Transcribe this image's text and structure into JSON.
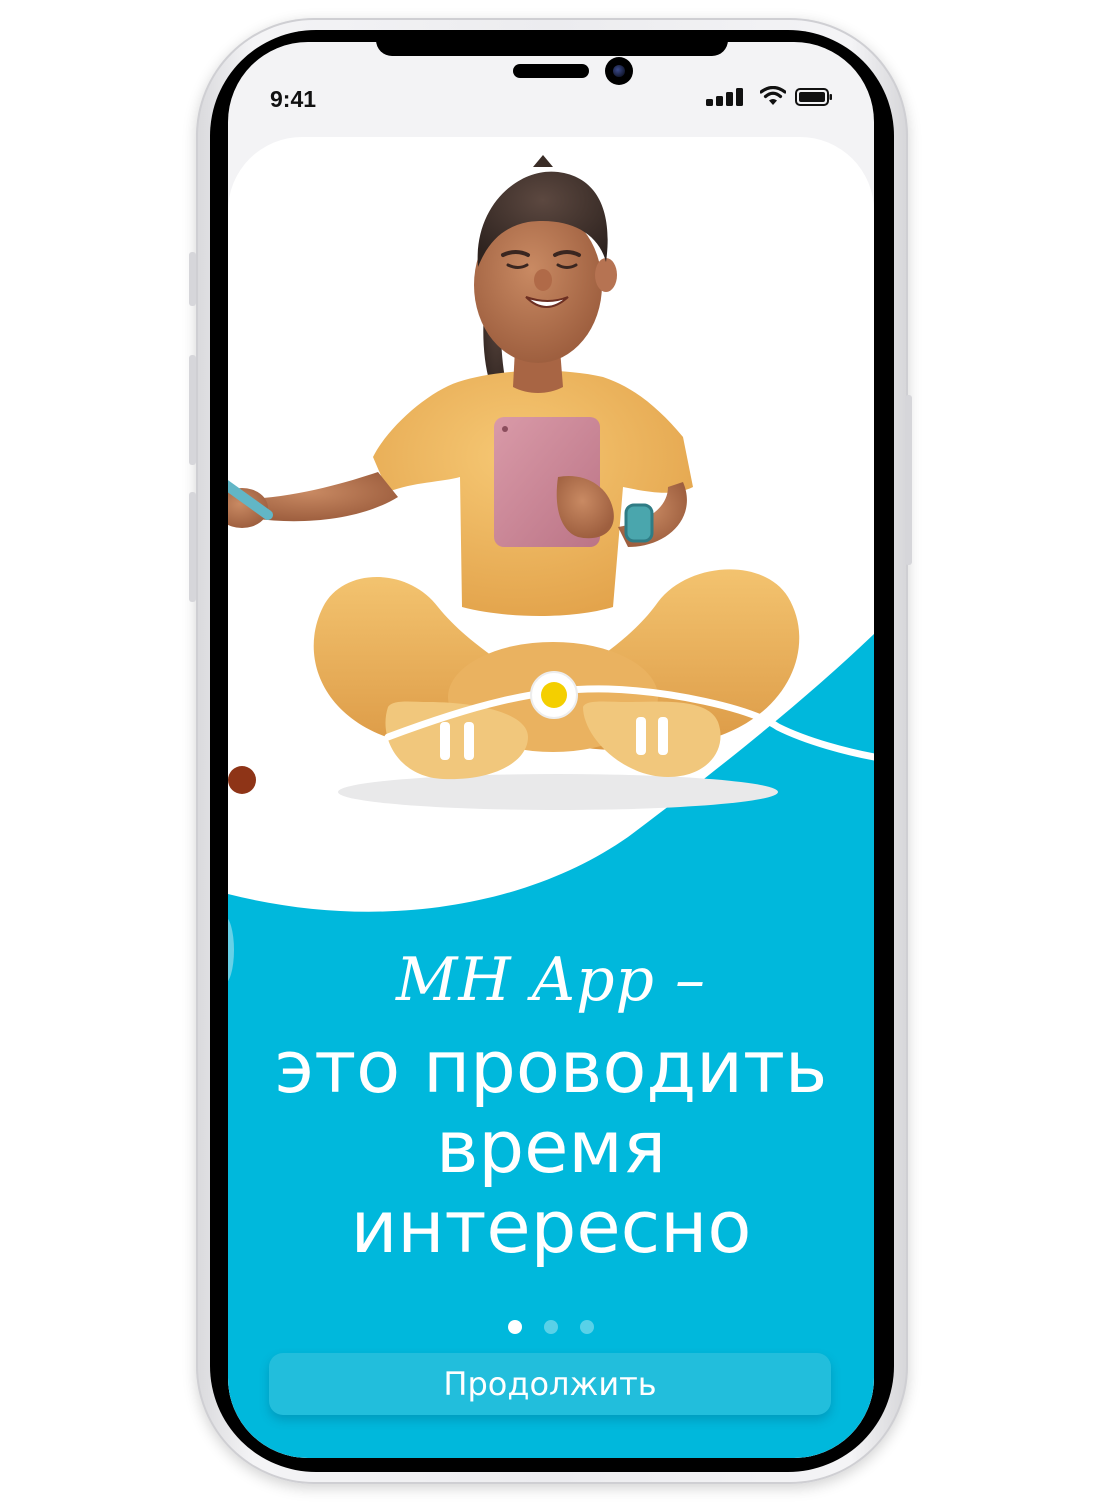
{
  "status_bar": {
    "time": "9:41",
    "icons": [
      "signal-icon",
      "wifi-icon",
      "battery-icon"
    ]
  },
  "illustration": {
    "subject": "3D person sitting cross-legged holding a tablet",
    "icon": "person-with-tablet-illustration"
  },
  "onboarding": {
    "title_script": "MH App –",
    "title_lines": [
      "это проводить",
      "время",
      "интересно"
    ],
    "page_indicator": {
      "total": 3,
      "active": 1
    },
    "continue_label": "Продолжить"
  },
  "colors": {
    "accent": "#00b8dc",
    "button": "#22bedc",
    "indicator_yellow": "#f4cf00",
    "shirt": "#f2bb5e",
    "tablet": "#cf8a9a"
  }
}
